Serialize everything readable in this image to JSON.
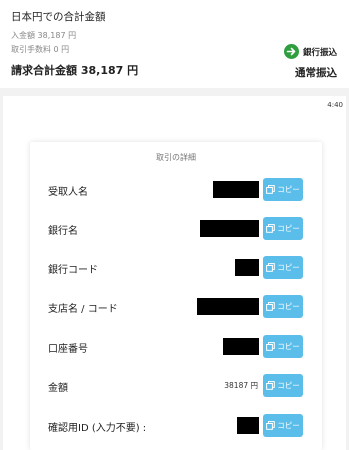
{
  "summary": {
    "title": "日本円での合計金額",
    "deposit": "入金額 38,187 円",
    "fee": "取引手数料 0 円",
    "total": "請求合計金額 38,187 円",
    "method_label": "銀行振込",
    "method_type": "通常振込"
  },
  "timer": "4:40",
  "card": {
    "title": "取引の詳細",
    "copy_label": "コピー",
    "rows": [
      {
        "label": "受取人名",
        "value": ""
      },
      {
        "label": "銀行名",
        "value": ""
      },
      {
        "label": "銀行コード",
        "value": ""
      },
      {
        "label": "支店名 / コード",
        "value": ""
      },
      {
        "label": "口座番号",
        "value": ""
      },
      {
        "label": "金額",
        "value": "38187 円"
      },
      {
        "label": "確認用ID (入力不要) :",
        "value": ""
      }
    ]
  },
  "colors": {
    "accent": "#5bbde9",
    "method_icon": "#2e9e3e"
  }
}
